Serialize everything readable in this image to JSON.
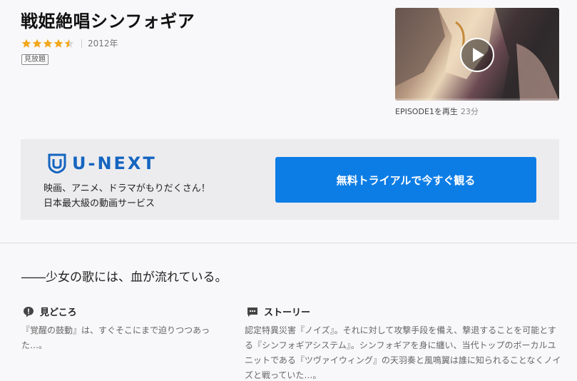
{
  "title": "戦姫絶唱シンフォギア",
  "rating": {
    "value": 4.5,
    "max": 5,
    "color": "#f2a81d"
  },
  "year": "2012年",
  "badge": "見放題",
  "thumbnail": {
    "play_icon": "play-icon"
  },
  "episode": {
    "label": "EPISODE1を再生",
    "duration": "23分"
  },
  "promo": {
    "logo_text": "U-NEXT",
    "logo_icon": "u-next-shield-icon",
    "line1": "映画、アニメ、ドラマがもりだくさん！",
    "line2": "日本最大級の動画サービス",
    "cta_label": "無料トライアルで今すぐ観る",
    "cta_color": "#0d7de6"
  },
  "catchphrase": "――少女の歌には、血が流れている。",
  "highlights": {
    "heading": "見どころ",
    "icon": "speech-bubble-exclamation-icon",
    "body": "『覚醒の鼓動』は、すぐそこにまで迫りつつあった…。"
  },
  "story": {
    "heading": "ストーリー",
    "icon": "speech-bubble-dots-icon",
    "body": "認定特異災害『ノイズ』。それに対して攻撃手段を備え、撃退することを可能とする『シンフォギアシステム』。シンフォギアを身に纏い、当代トップのボーカルユニットである『ツヴァイウィング』の天羽奏と風鳴翼は誰に知られることなくノイズと戦っていた…。"
  }
}
